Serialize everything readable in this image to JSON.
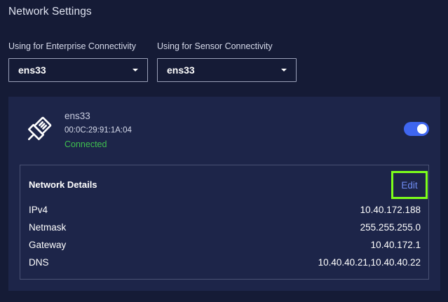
{
  "page": {
    "title": "Network Settings"
  },
  "selects": {
    "enterprise": {
      "label": "Using for Enterprise Connectivity",
      "value": "ens33"
    },
    "sensor": {
      "label": "Using for Sensor Connectivity",
      "value": "ens33"
    }
  },
  "interface": {
    "name": "ens33",
    "mac": "00:0C:29:91:1A:04",
    "status": "Connected",
    "enabled": true,
    "icon": "ethernet-plug-icon"
  },
  "details": {
    "title": "Network Details",
    "edit_label": "Edit",
    "rows": [
      {
        "label": "IPv4",
        "value": "10.40.172.188"
      },
      {
        "label": "Netmask",
        "value": "255.255.255.0"
      },
      {
        "label": "Gateway",
        "value": "10.40.172.1"
      },
      {
        "label": "DNS",
        "value": "10.40.40.21,10.40.40.22"
      }
    ]
  },
  "colors": {
    "background": "#151b36",
    "card": "#1d2549",
    "accent": "#3f66f0",
    "status_ok": "#3fbf4f",
    "highlight": "#7dff1a",
    "link": "#6f8cf2"
  }
}
